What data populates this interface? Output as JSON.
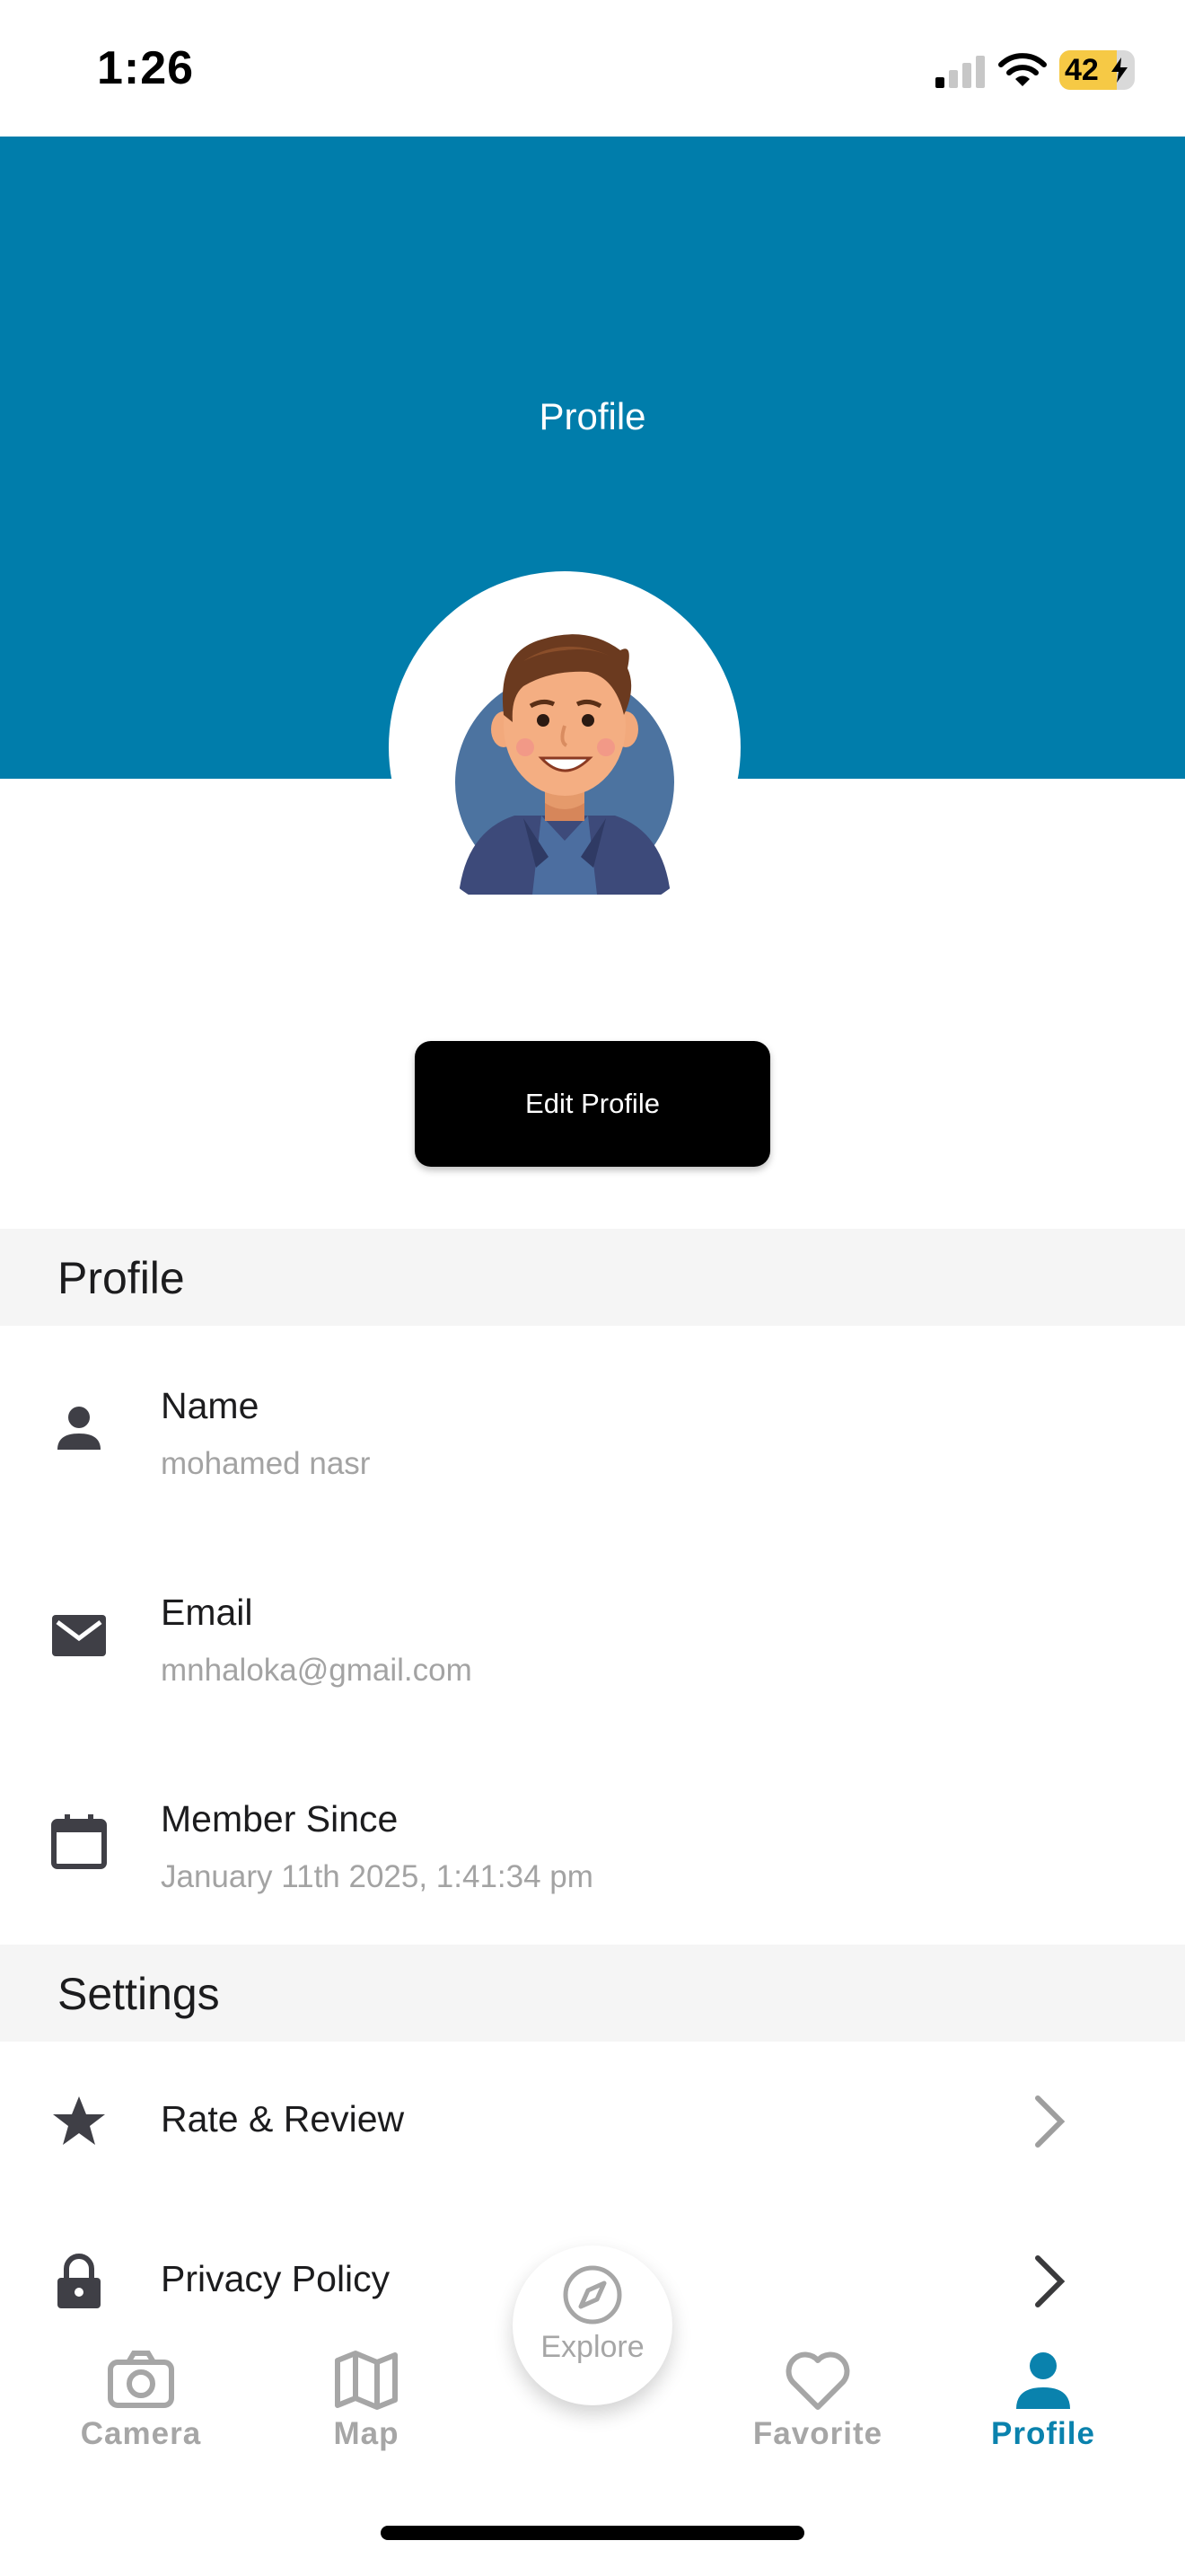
{
  "status_bar": {
    "time": "1:26",
    "battery": "42",
    "battery_level": 0.42
  },
  "header": {
    "title": "Profile"
  },
  "edit_button": {
    "label": "Edit Profile"
  },
  "profile_section": {
    "title": "Profile",
    "rows": [
      {
        "label": "Name",
        "value": "mohamed nasr",
        "icon": "person-icon"
      },
      {
        "label": "Email",
        "value": "mnhaloka@gmail.com",
        "icon": "mail-icon"
      },
      {
        "label": "Member Since",
        "value": "January 11th 2025, 1:41:34 pm",
        "icon": "calendar-icon"
      }
    ]
  },
  "settings_section": {
    "title": "Settings",
    "rows": [
      {
        "label": "Rate & Review",
        "icon": "star-icon"
      },
      {
        "label": "Privacy Policy",
        "icon": "lock-icon"
      }
    ]
  },
  "tab_bar": {
    "tabs": [
      {
        "label": "Camera",
        "icon": "camera-icon"
      },
      {
        "label": "Map",
        "icon": "map-icon"
      },
      {
        "label": "Favorite",
        "icon": "heart-icon"
      },
      {
        "label": "Profile",
        "icon": "person-icon",
        "active": true
      }
    ],
    "explore": {
      "label": "Explore",
      "icon": "compass-icon"
    }
  },
  "colors": {
    "header": "#007dab",
    "accent": "#0a82ad",
    "inactive": "#a6a6a6"
  }
}
